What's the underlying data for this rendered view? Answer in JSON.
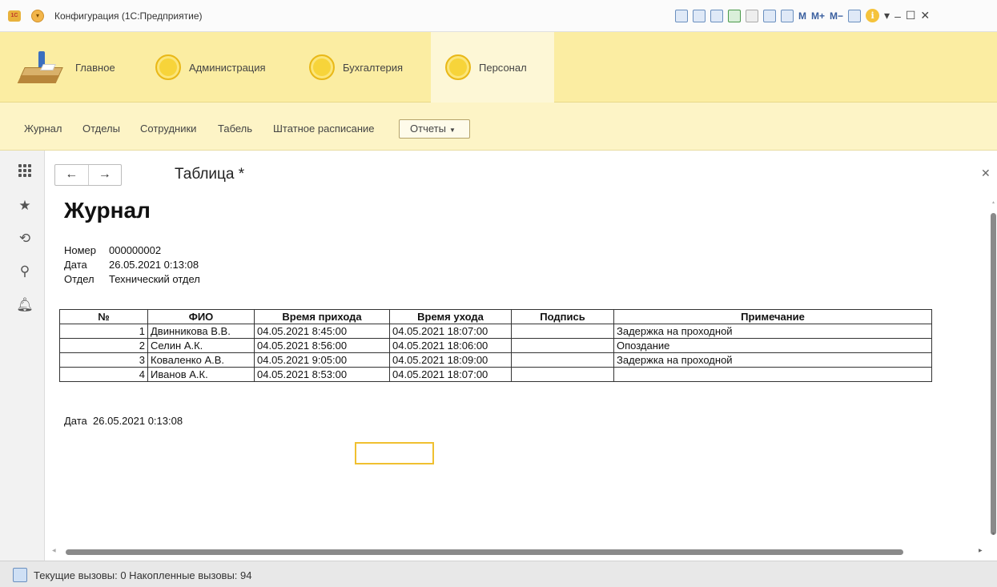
{
  "window": {
    "app_logo": "1С",
    "title": "Конфигурация (1С:Предприятие)",
    "toolbar": {
      "m": "M",
      "m_plus": "M+",
      "m_minus": "M−"
    }
  },
  "sections": [
    {
      "label": "Главное",
      "icon": "desk-icon"
    },
    {
      "label": "Администрация",
      "icon": "circle-icon"
    },
    {
      "label": "Бухгалтерия",
      "icon": "circle-icon"
    },
    {
      "label": "Персонал",
      "icon": "circle-icon",
      "active": true
    }
  ],
  "function_panel": {
    "items": [
      "Журнал",
      "Отделы",
      "Сотрудники",
      "Табель",
      "Штатное расписание"
    ],
    "reports": "Отчеты"
  },
  "document": {
    "tab_title": "Таблица *",
    "heading": "Журнал",
    "number_label": "Номер",
    "number": "000000002",
    "date_label": "Дата",
    "date": "26.05.2021 0:13:08",
    "dept_label": "Отдел",
    "dept": "Технический отдел",
    "table": {
      "headers": [
        "№",
        "ФИО",
        "Время прихода",
        "Время ухода",
        "Подпись",
        "Примечание"
      ],
      "rows": [
        [
          "1",
          "Двинникова В.В.",
          "04.05.2021 8:45:00",
          "04.05.2021 18:07:00",
          "",
          "Задержка на проходной"
        ],
        [
          "2",
          "Селин А.К.",
          "04.05.2021 8:56:00",
          "04.05.2021 18:06:00",
          "",
          "Опоздание"
        ],
        [
          "3",
          "Коваленко А.В.",
          "04.05.2021 9:05:00",
          "04.05.2021 18:09:00",
          "",
          "Задержка на проходной"
        ],
        [
          "4",
          "Иванов А.К.",
          "04.05.2021 8:53:00",
          "04.05.2021 18:07:00",
          "",
          ""
        ]
      ]
    },
    "footer_date_label": "Дата",
    "footer_date": "26.05.2021 0:13:08"
  },
  "status": {
    "text": "Текущие вызовы: 0   Накопленные вызовы: 94"
  }
}
